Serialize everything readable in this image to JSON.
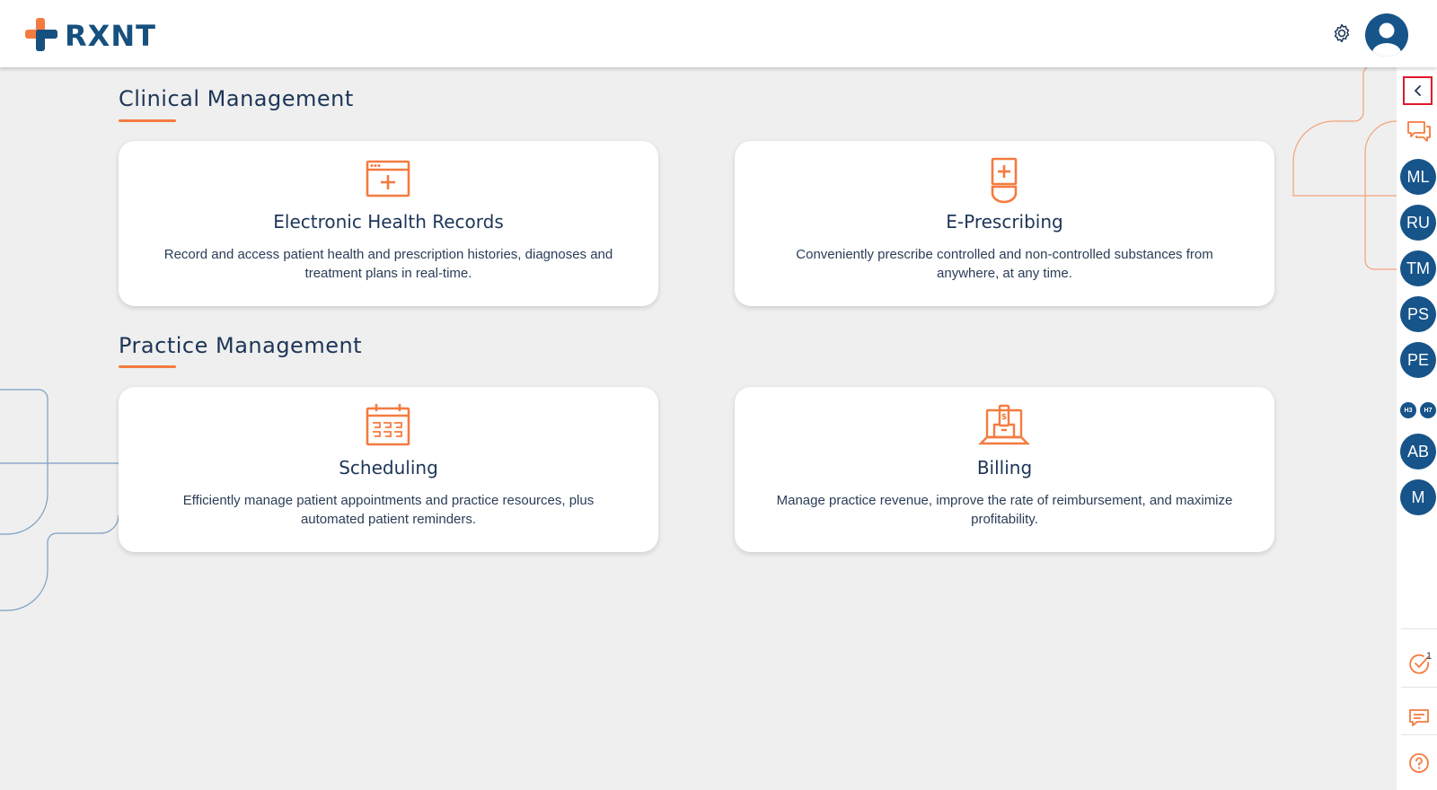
{
  "header": {
    "logo_text": "RXNT",
    "icons": [
      "settings-icon",
      "user-avatar-icon"
    ]
  },
  "sections": [
    {
      "title": "Clinical Management",
      "cards": [
        {
          "icon": "health-record-icon",
          "title": "Electronic Health Records",
          "description": "Record and access patient health and prescription histories, diagnoses and treatment plans in real-time."
        },
        {
          "icon": "prescription-bottle-icon",
          "title": "E-Prescribing",
          "description": "Conveniently prescribe controlled and non-controlled substances from anywhere, at any time."
        }
      ]
    },
    {
      "title": "Practice Management",
      "cards": [
        {
          "icon": "calendar-icon",
          "title": "Scheduling",
          "description": "Efficiently manage patient appointments and practice resources, plus automated patient reminders."
        },
        {
          "icon": "billing-laptop-icon",
          "title": "Billing",
          "description": "Manage practice revenue, improve the rate of reimbursement, and maximize profitability."
        }
      ]
    }
  ],
  "right_sidebar": {
    "collapse_icon": "chevron-left-icon",
    "chat_icon": "chat-bubbles-icon",
    "contacts": [
      "ML",
      "RU",
      "TM",
      "PS",
      "PE"
    ],
    "mini_contacts": [
      "H3",
      "H7"
    ],
    "contacts_more": [
      "AB",
      "M"
    ],
    "tasks_badge": "1",
    "bottom_icons": [
      "task-check-icon",
      "message-icon",
      "help-icon"
    ]
  },
  "colors": {
    "accent": "#f47b3f",
    "brand_blue": "#16548a",
    "text": "#1d3557",
    "background": "#efefef"
  }
}
